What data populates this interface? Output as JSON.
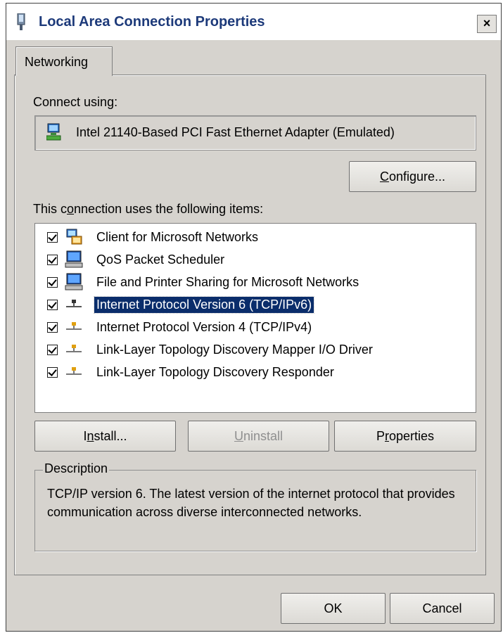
{
  "window": {
    "title": "Local Area Connection Properties",
    "close_glyph": "×"
  },
  "tabs": [
    {
      "label": "Networking"
    }
  ],
  "connect": {
    "label": "Connect using:",
    "adapter_name": "Intel 21140-Based PCI Fast Ethernet Adapter (Emulated)",
    "adapter_icon": "network-adapter-icon"
  },
  "buttons": {
    "configure": {
      "pre": "",
      "key": "C",
      "post": "onfigure..."
    },
    "install": {
      "pre": "I",
      "key": "n",
      "post": "stall..."
    },
    "uninstall": {
      "pre": "",
      "key": "U",
      "post": "ninstall"
    },
    "properties": {
      "pre": "P",
      "key": "r",
      "post": "operties"
    },
    "ok": "OK",
    "cancel": "Cancel"
  },
  "items_label": {
    "pre": "This c",
    "key": "o",
    "post": "nnection uses the following items:"
  },
  "items": [
    {
      "label": "Client for Microsoft Networks",
      "checked": true,
      "icon": "network-client-icon",
      "selected": false
    },
    {
      "label": "QoS Packet Scheduler",
      "checked": true,
      "icon": "computer-service-icon",
      "selected": false
    },
    {
      "label": "File and Printer Sharing for Microsoft Networks",
      "checked": true,
      "icon": "computer-service-icon",
      "selected": false
    },
    {
      "label": "Internet Protocol Version 6 (TCP/IPv6)",
      "checked": true,
      "icon": "protocol-icon",
      "selected": true
    },
    {
      "label": "Internet Protocol Version 4 (TCP/IPv4)",
      "checked": true,
      "icon": "protocol-icon",
      "selected": false
    },
    {
      "label": "Link-Layer Topology Discovery Mapper I/O Driver",
      "checked": true,
      "icon": "protocol-icon",
      "selected": false
    },
    {
      "label": "Link-Layer Topology Discovery Responder",
      "checked": true,
      "icon": "protocol-icon",
      "selected": false
    }
  ],
  "description": {
    "legend": "Description",
    "text": "TCP/IP version 6. The latest version of the internet protocol that provides communication across diverse interconnected networks."
  },
  "colors": {
    "dialog_bg": "#d6d3ce",
    "selection_bg": "#0a2d6b",
    "title_text": "#1d3a7a"
  }
}
